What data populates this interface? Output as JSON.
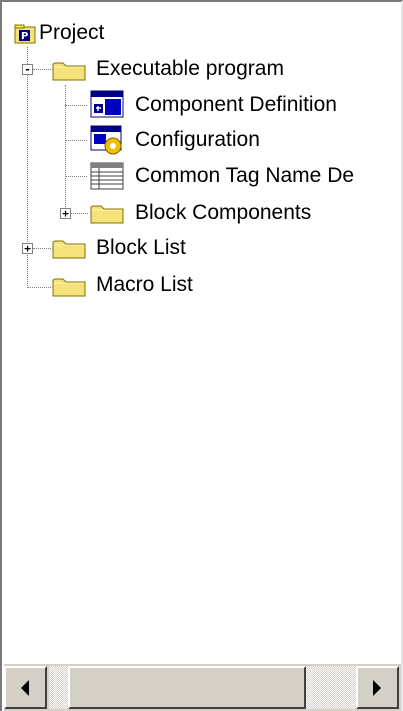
{
  "tree": {
    "root": {
      "label": "Project",
      "icon": "project-icon"
    },
    "executable": {
      "label": "Executable program",
      "icon": "folder-icon",
      "expander": "-"
    },
    "component_definition": {
      "label": "Component Definition",
      "icon": "component-definition-icon"
    },
    "configuration": {
      "label": "Configuration",
      "icon": "configuration-icon"
    },
    "common_tag": {
      "label": "Common Tag Name De",
      "icon": "table-icon"
    },
    "block_components": {
      "label": "Block Components",
      "icon": "folder-icon",
      "expander": "+"
    },
    "block_list": {
      "label": "Block List",
      "icon": "folder-icon",
      "expander": "+"
    },
    "macro_list": {
      "label": "Macro List",
      "icon": "folder-icon"
    }
  },
  "scrollbar": {
    "left_icon": "scroll-left-icon",
    "right_icon": "scroll-right-icon"
  },
  "colors": {
    "folder": "#f5e27a",
    "folder_border": "#807000",
    "selected_blue": "#0000a0"
  }
}
